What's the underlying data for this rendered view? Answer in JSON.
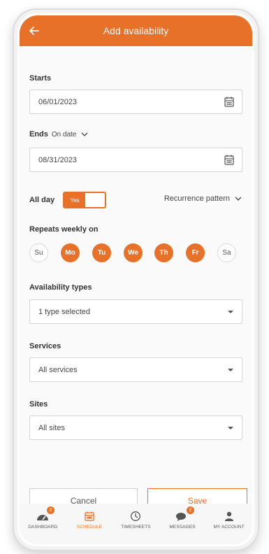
{
  "header": {
    "title": "Add availability"
  },
  "starts": {
    "label": "Starts",
    "value": "06/01/2023"
  },
  "ends": {
    "label": "Ends",
    "mode": "On date",
    "value": "08/31/2023"
  },
  "allday": {
    "label": "All day",
    "toggle_text": "Yes",
    "recurrence_label": "Recurrence pattern"
  },
  "repeats": {
    "label": "Repeats weekly on",
    "days": [
      {
        "label": "Su",
        "selected": false
      },
      {
        "label": "Mo",
        "selected": true
      },
      {
        "label": "Tu",
        "selected": true
      },
      {
        "label": "We",
        "selected": true
      },
      {
        "label": "Th",
        "selected": true
      },
      {
        "label": "Fr",
        "selected": true
      },
      {
        "label": "Sa",
        "selected": false
      }
    ]
  },
  "availability_types": {
    "label": "Availability types",
    "value": "1 type selected"
  },
  "services": {
    "label": "Services",
    "value": "All services"
  },
  "sites": {
    "label": "Sites",
    "value": "All sites"
  },
  "actions": {
    "cancel": "Cancel",
    "save": "Save"
  },
  "nav": {
    "items": [
      {
        "label": "DASHBOARD",
        "icon": "dashboard-icon",
        "badge": "2"
      },
      {
        "label": "SCHEDULE",
        "icon": "calendar-icon",
        "active": true
      },
      {
        "label": "TIMESHEETS",
        "icon": "clock-icon"
      },
      {
        "label": "MESSAGES",
        "icon": "chat-icon",
        "badge": "2"
      },
      {
        "label": "MY ACCOUNT",
        "icon": "person-icon"
      }
    ]
  },
  "colors": {
    "accent": "#e8712a",
    "background": "#fafafa"
  }
}
